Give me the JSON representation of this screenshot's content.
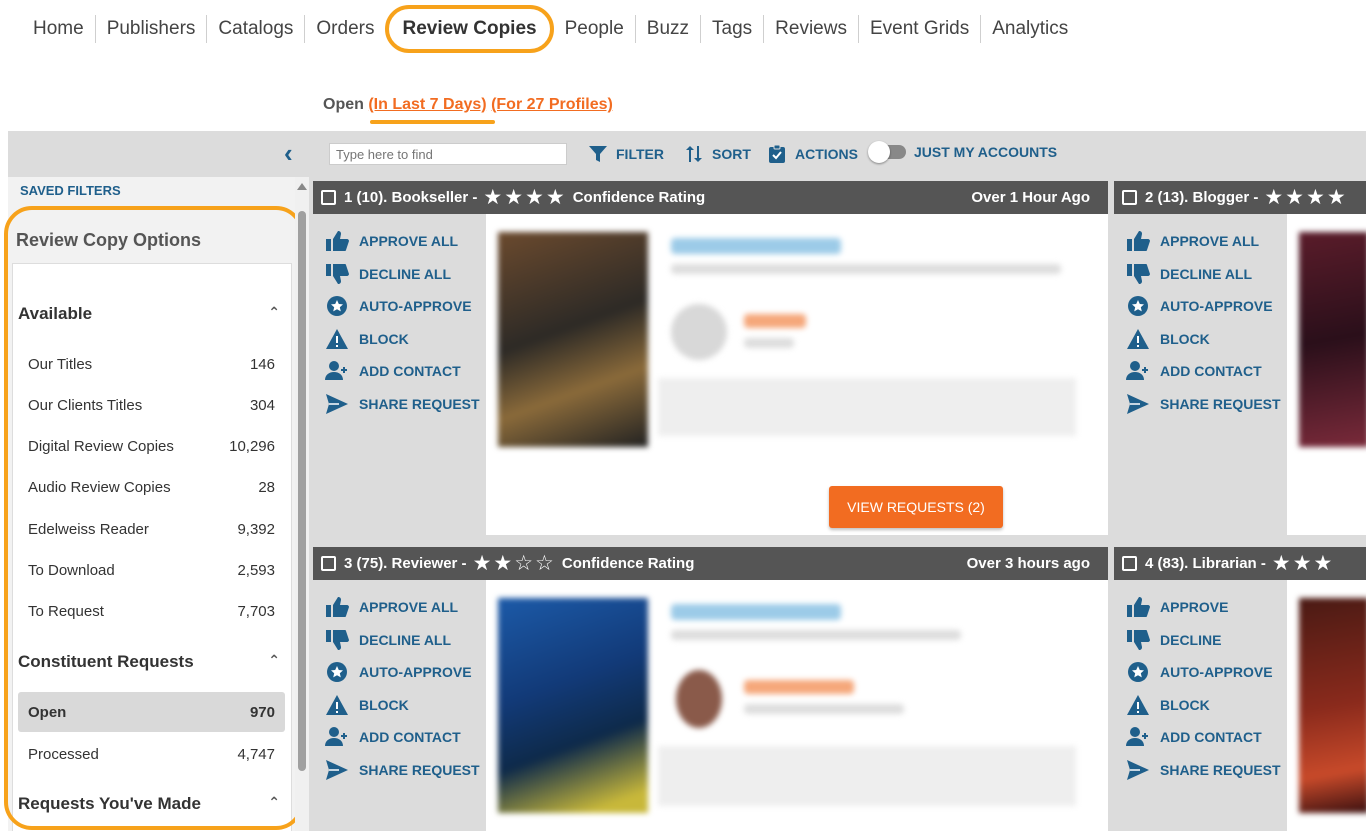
{
  "nav": {
    "items": [
      "Home",
      "Publishers",
      "Catalogs",
      "Orders",
      "Review Copies",
      "People",
      "Buzz",
      "Tags",
      "Reviews",
      "Event Grids",
      "Analytics"
    ]
  },
  "subhead": {
    "status": "Open",
    "range": "(In Last 7 Days)",
    "profiles": "(For 27 Profiles)"
  },
  "toolbar": {
    "search_placeholder": "Type here to find",
    "filter": "FILTER",
    "sort": "SORT",
    "actions": "ACTIONS",
    "just_my_accounts": "JUST MY ACCOUNTS"
  },
  "sidebar": {
    "saved_filters": "SAVED FILTERS",
    "title": "Review Copy Options",
    "available": {
      "heading": "Available",
      "items": [
        {
          "label": "Our Titles",
          "count": "146"
        },
        {
          "label": "Our Clients Titles",
          "count": "304"
        },
        {
          "label": "Digital Review Copies",
          "count": "10,296"
        },
        {
          "label": "Audio Review Copies",
          "count": "28"
        },
        {
          "label": "Edelweiss Reader",
          "count": "9,392"
        },
        {
          "label": "To Download",
          "count": "2,593"
        },
        {
          "label": "To Request",
          "count": "7,703"
        }
      ]
    },
    "constituent": {
      "heading": "Constituent Requests",
      "items": [
        {
          "label": "Open",
          "count": "970"
        },
        {
          "label": "Processed",
          "count": "4,747"
        }
      ]
    },
    "made": {
      "heading": "Requests You've Made"
    }
  },
  "cards": [
    {
      "title": "1 (10). Bookseller -",
      "stars": "★★★★",
      "rating_label": "Confidence Rating",
      "time": "Over 1 Hour Ago",
      "actions": [
        "APPROVE ALL",
        "DECLINE ALL",
        "AUTO-APPROVE",
        "BLOCK",
        "ADD CONTACT",
        "SHARE REQUEST"
      ],
      "view_button": "VIEW REQUESTS (2)"
    },
    {
      "title": "2 (13). Blogger -",
      "stars": "★★★★",
      "actions": [
        "APPROVE ALL",
        "DECLINE ALL",
        "AUTO-APPROVE",
        "BLOCK",
        "ADD CONTACT",
        "SHARE REQUEST"
      ]
    },
    {
      "title": "3 (75). Reviewer -",
      "stars": "★★☆☆",
      "rating_label": "Confidence Rating",
      "time": "Over 3 hours ago",
      "actions": [
        "APPROVE ALL",
        "DECLINE ALL",
        "AUTO-APPROVE",
        "BLOCK",
        "ADD CONTACT",
        "SHARE REQUEST"
      ]
    },
    {
      "title": "4 (83). Librarian -",
      "stars": "★★★",
      "actions": [
        "APPROVE",
        "DECLINE",
        "AUTO-APPROVE",
        "BLOCK",
        "ADD CONTACT",
        "SHARE REQUEST"
      ]
    }
  ],
  "colors": {
    "accent_orange": "#f26c21",
    "highlight": "#f7a21b",
    "link_blue": "#1f5f8b",
    "card_header": "#555555"
  }
}
